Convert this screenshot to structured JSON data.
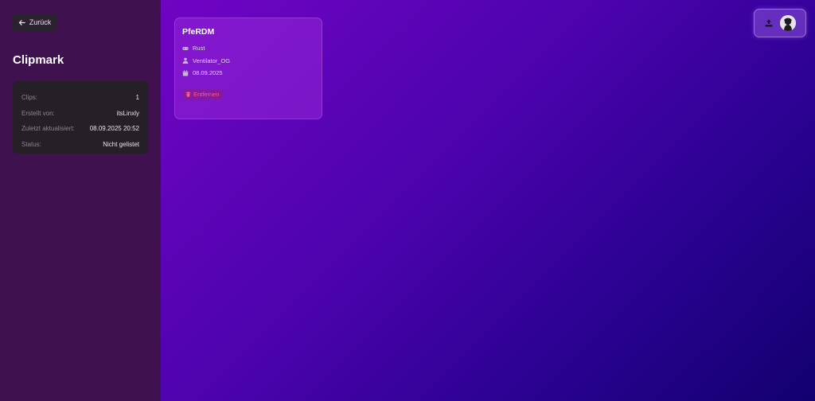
{
  "sidebar": {
    "back_label": "Zurück",
    "title": "Clipmark",
    "info": [
      {
        "label": "Clips:",
        "value": "1"
      },
      {
        "label": "Erstellt von:",
        "value": "itsLinxly"
      },
      {
        "label": "Zuletzt aktualisiert:",
        "value": "08.09.2025 20:52"
      },
      {
        "label": "Status:",
        "value": "Nicht gelistet"
      }
    ]
  },
  "clip": {
    "title": "PfeRDM",
    "game": "Rust",
    "user": "Ventilator_OG",
    "date": "08.09.2025",
    "remove_label": "Entfernen"
  },
  "header": {
    "upload_icon": "upload-icon",
    "avatar_icon": "avatar"
  },
  "colors": {
    "sidebar_bg": "#3f114f",
    "card_bg": "#242026",
    "remove_text": "#ff5a8a",
    "gradient_start": "#7a06c4",
    "gradient_end": "#12006f"
  }
}
